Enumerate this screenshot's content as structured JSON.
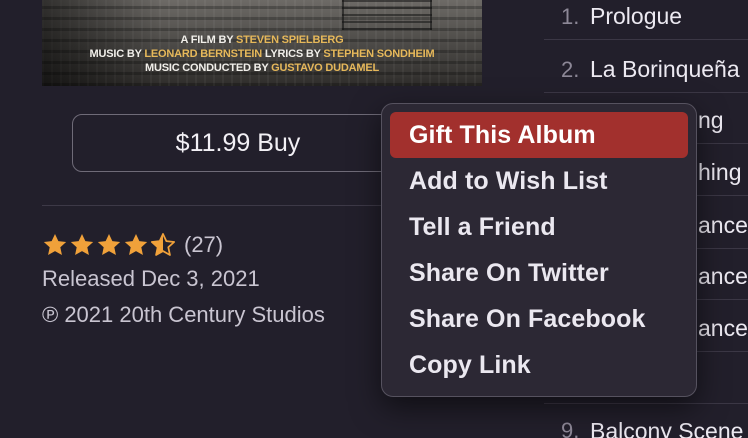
{
  "album": {
    "credit_lines": [
      [
        "A FILM BY ",
        "STEVEN SPIELBERG"
      ],
      [
        "MUSIC BY ",
        "LEONARD BERNSTEIN",
        " LYRICS BY ",
        "STEPHEN SONDHEIM"
      ],
      [
        "MUSIC CONDUCTED BY ",
        "GUSTAVO DUDAMEL"
      ]
    ],
    "buy_label": "$11.99 Buy",
    "rating_stars": 4.5,
    "rating_count": "(27)",
    "released": "Released Dec 3, 2021",
    "copyright": "℗ 2021 20th Century Studios"
  },
  "tracks": [
    {
      "num": "1.",
      "title": "Prologue"
    },
    {
      "num": "2.",
      "title": "La Borinqueña"
    },
    {
      "num": "",
      "title": "ng"
    },
    {
      "num": "",
      "title": "hing"
    },
    {
      "num": "",
      "title": "ance"
    },
    {
      "num": "",
      "title": "ance"
    },
    {
      "num": "",
      "title": "ance"
    },
    {
      "num": "",
      "title": ""
    },
    {
      "num": "9.",
      "title": "Balcony Scene"
    }
  ],
  "context_menu": {
    "items": [
      {
        "label": "Gift This Album",
        "highlighted": true
      },
      {
        "label": "Add to Wish List",
        "highlighted": false
      },
      {
        "label": "Tell a Friend",
        "highlighted": false
      },
      {
        "label": "Share On Twitter",
        "highlighted": false
      },
      {
        "label": "Share On Facebook",
        "highlighted": false
      },
      {
        "label": "Copy Link",
        "highlighted": false
      }
    ]
  },
  "colors": {
    "background": "#221f2b",
    "highlight": "#a2302d",
    "star": "#f0a13a",
    "credit_accent": "#e6b85a"
  },
  "icons": {
    "star": "star-icon",
    "half_star": "star-half-icon"
  }
}
